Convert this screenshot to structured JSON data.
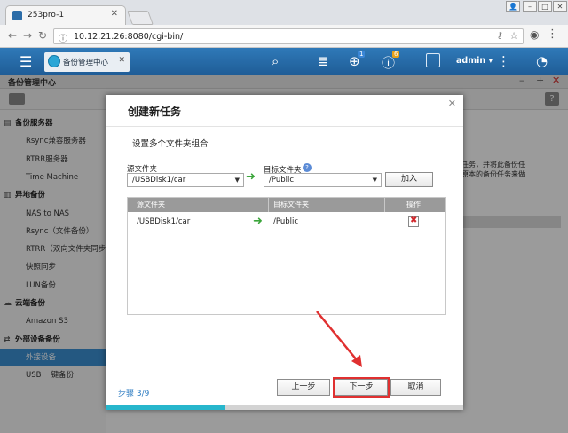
{
  "browser": {
    "tab_title": "253pro-1",
    "url": "10.12.21.26:8080/cgi-bin/"
  },
  "app": {
    "window_tab": "备份管理中心",
    "user": "admin",
    "notifications": {
      "updates_badge": "1",
      "info_badge": "6"
    },
    "window_title": "备份管理中心"
  },
  "sidebar": {
    "items": [
      {
        "label": "备份服务器",
        "type": "section"
      },
      {
        "label": "Rsync兼容服务器",
        "type": "sub"
      },
      {
        "label": "RTRR服务器",
        "type": "sub"
      },
      {
        "label": "Time Machine",
        "type": "sub"
      },
      {
        "label": "异地备份",
        "type": "section"
      },
      {
        "label": "NAS to NAS",
        "type": "sub"
      },
      {
        "label": "Rsync（文件备份）",
        "type": "sub"
      },
      {
        "label": "RTRR（双向文件夹同步",
        "type": "sub"
      },
      {
        "label": "快照同步",
        "type": "sub"
      },
      {
        "label": "LUN备份",
        "type": "sub"
      },
      {
        "label": "云端备份",
        "type": "section"
      },
      {
        "label": "Amazon S3",
        "type": "sub"
      },
      {
        "label": "外部设备备份",
        "type": "section"
      },
      {
        "label": "外接设备",
        "type": "sub",
        "active": true
      },
      {
        "label": "USB 一键备份",
        "type": "sub"
      }
    ]
  },
  "background": {
    "text_line1": "任务，并将此备份任",
    "text_line2": "原本的备份任务来做"
  },
  "modal": {
    "title": "创建新任务",
    "subtitle": "设置多个文件夹组合",
    "source_label": "源文件夹",
    "target_label": "目标文件夹",
    "source_value": "/USBDisk1/car",
    "target_value": "/Public",
    "add_button": "加入",
    "table": {
      "headers": [
        "源文件夹",
        "目标文件夹",
        "操作"
      ],
      "rows": [
        {
          "source": "/USBDisk1/car",
          "target": "/Public"
        }
      ]
    },
    "step": "步骤 3/9",
    "progress": 0.333,
    "buttons": {
      "prev": "上一步",
      "next": "下一步",
      "cancel": "取消"
    }
  },
  "colors": {
    "appbar": "#2f79b8",
    "accent": "#3b8fd1",
    "progress": "#27b6cc",
    "annotation": "#e03030",
    "arrow_green": "#3aa53a"
  }
}
